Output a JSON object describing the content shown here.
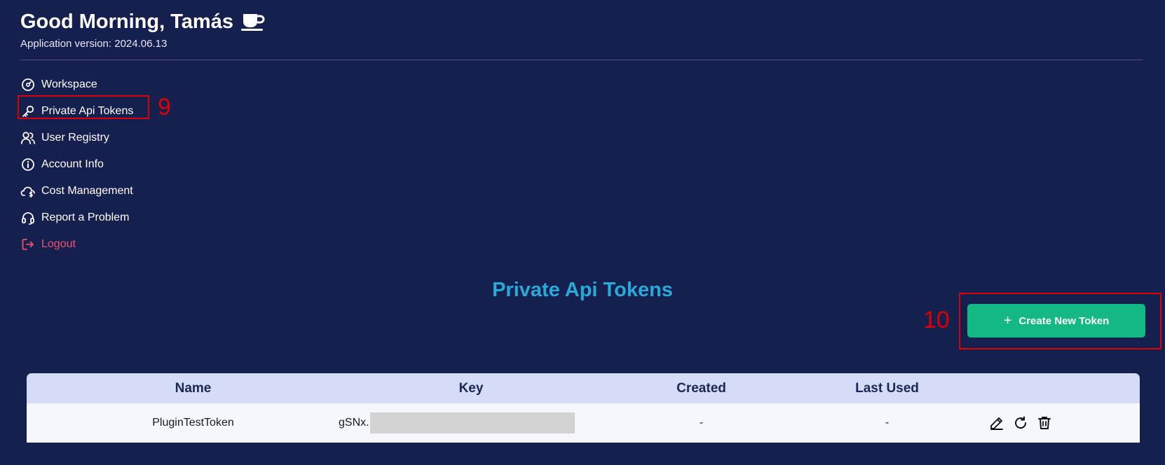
{
  "header": {
    "greeting": "Good Morning, Tamás",
    "greeting_icon": "coffee-cup-icon",
    "version_label": "Application version: 2024.06.13"
  },
  "nav": {
    "items": [
      {
        "label": "Workspace",
        "icon": "workspace-icon"
      },
      {
        "label": "Private Api Tokens",
        "icon": "key-icon"
      },
      {
        "label": "User Registry",
        "icon": "users-icon"
      },
      {
        "label": "Account Info",
        "icon": "info-icon"
      },
      {
        "label": "Cost Management",
        "icon": "cloud-dollar-icon"
      },
      {
        "label": "Report a Problem",
        "icon": "headset-icon"
      },
      {
        "label": "Logout",
        "icon": "logout-icon"
      }
    ]
  },
  "annotations": {
    "step_9": "9",
    "step_10": "10"
  },
  "main": {
    "title": "Private Api Tokens",
    "create_button_label": "Create New Token",
    "create_button_icon": "plus-icon"
  },
  "table": {
    "columns": [
      "Name",
      "Key",
      "Created",
      "Last Used"
    ],
    "rows": [
      {
        "name": "PluginTestToken",
        "key_prefix": "gSNx.",
        "created": "-",
        "last_used": "-",
        "actions": [
          "edit-icon",
          "refresh-icon",
          "trash-icon"
        ]
      }
    ]
  },
  "colors": {
    "background": "#15204f",
    "title_accent": "#2aa9d9",
    "primary_button": "#14b883",
    "logout_text": "#f0506e",
    "annotation_red": "#e00000",
    "table_header": "#d4dcf8",
    "table_row": "#f5f7fc"
  }
}
